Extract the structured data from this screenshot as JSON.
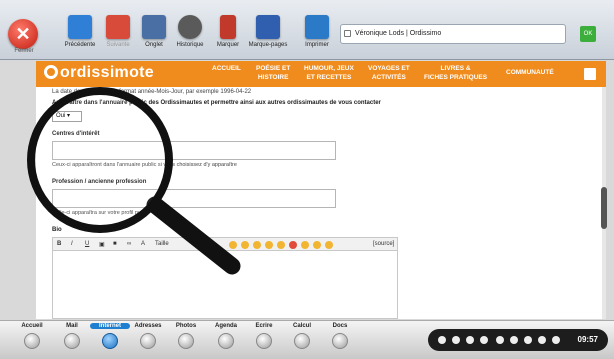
{
  "toolbar": {
    "close_label": "Fermer",
    "buttons": [
      {
        "label": "Précédente",
        "color": "#2f7fd6",
        "enabled": true
      },
      {
        "label": "Suivante",
        "color": "#d84a3a",
        "enabled": false
      },
      {
        "label": "Onglet",
        "color": "#4a6fa5",
        "enabled": true
      },
      {
        "label": "Historique",
        "color": "#5a5a5a",
        "enabled": true
      },
      {
        "label": "Marquer",
        "color": "#c0392b",
        "enabled": true
      },
      {
        "label": "Marque-pages",
        "color": "#2f5fae",
        "enabled": true
      },
      {
        "label": "Imprimer",
        "color": "#2a7ac7",
        "enabled": true
      }
    ],
    "url_text": "Véronique Lods | Ordissimo",
    "ok_label": "OK"
  },
  "site_nav": {
    "logo": "ordissimote",
    "items": [
      {
        "line1": "ACCUEIL",
        "line2": ""
      },
      {
        "line1": "POÉSIE ET",
        "line2": "HISTOIRE"
      },
      {
        "line1": "HUMOUR, JEUX",
        "line2": "ET RECETTES"
      },
      {
        "line1": "VOYAGES ET",
        "line2": "ACTIVITÉS"
      },
      {
        "line1": "LIVRES &",
        "line2": "FICHES PRATIQUES"
      },
      {
        "line1": "COMMUNAUTÉ",
        "line2": ""
      }
    ]
  },
  "form": {
    "date_hint": "La date de naissance au format année-Mois-Jour, par exemple 1996-04-22",
    "directory_label": "Apparaître dans l'annuaire public des Ordissimautes et permettre ainsi aux autres ordissimautes de vous contacter",
    "directory_value": "Oui",
    "interests_label": "Centres d'intérêt",
    "interests_hint": "Ceux-ci apparaîtront dans l'annuaire public si vous choisissez d'y apparaître",
    "profession_label": "Profession / ancienne profession",
    "profession_hint": "Celle-ci apparaîtra sur votre profil public",
    "bio_label": "Bio",
    "editor_source": "[source]",
    "editor_style": "Taille"
  },
  "dock": {
    "items": [
      "Accueil",
      "Mail",
      "Internet",
      "Adresses",
      "Photos",
      "Agenda",
      "Ecrire",
      "Calcul",
      "Docs"
    ],
    "active": "Internet",
    "clock": "09:57"
  }
}
